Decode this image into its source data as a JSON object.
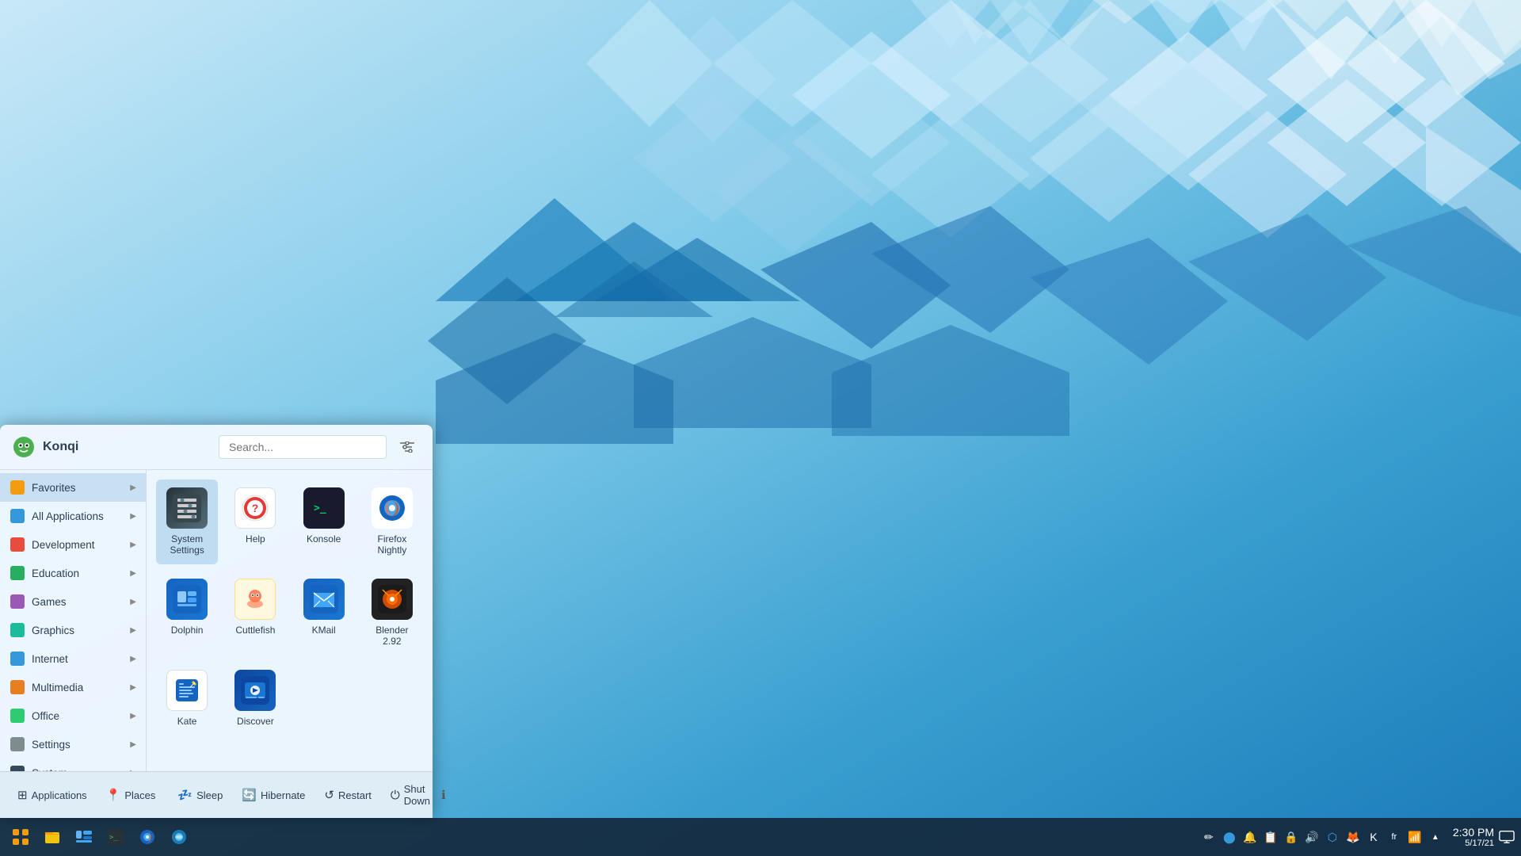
{
  "desktop": {
    "background_color": "#5ab4e0"
  },
  "menu": {
    "title": "Konqi",
    "search_placeholder": "Search...",
    "sidebar": {
      "items": [
        {
          "id": "favorites",
          "label": "Favorites",
          "icon": "☆",
          "active": true,
          "has_arrow": true
        },
        {
          "id": "all-applications",
          "label": "All Applications",
          "icon": "⊞",
          "active": false,
          "has_arrow": true
        },
        {
          "id": "development",
          "label": "Development",
          "icon": "🔧",
          "active": false,
          "has_arrow": true
        },
        {
          "id": "education",
          "label": "Education",
          "icon": "🎓",
          "active": false,
          "has_arrow": true
        },
        {
          "id": "games",
          "label": "Games",
          "icon": "🎮",
          "active": false,
          "has_arrow": true
        },
        {
          "id": "graphics",
          "label": "Graphics",
          "icon": "🎨",
          "active": false,
          "has_arrow": true
        },
        {
          "id": "internet",
          "label": "Internet",
          "icon": "🌐",
          "active": false,
          "has_arrow": true
        },
        {
          "id": "multimedia",
          "label": "Multimedia",
          "icon": "🎵",
          "active": false,
          "has_arrow": true
        },
        {
          "id": "office",
          "label": "Office",
          "icon": "📄",
          "active": false,
          "has_arrow": true
        },
        {
          "id": "settings",
          "label": "Settings",
          "icon": "⚙",
          "active": false,
          "has_arrow": true
        },
        {
          "id": "system",
          "label": "System",
          "icon": "💻",
          "active": false,
          "has_arrow": true
        }
      ]
    },
    "apps": [
      {
        "id": "system-settings",
        "label": "System Settings",
        "icon_type": "system-settings",
        "icon_char": "⚙"
      },
      {
        "id": "help",
        "label": "Help",
        "icon_type": "help",
        "icon_char": "🆘"
      },
      {
        "id": "konsole",
        "label": "Konsole",
        "icon_type": "konsole",
        "icon_char": ">_"
      },
      {
        "id": "firefox-nightly",
        "label": "Firefox Nightly",
        "icon_type": "firefox",
        "icon_char": "🦊"
      },
      {
        "id": "dolphin",
        "label": "Dolphin",
        "icon_type": "dolphin",
        "icon_char": "📁"
      },
      {
        "id": "cuttlefish",
        "label": "Cuttlefish",
        "icon_type": "cuttlefish",
        "icon_char": "🐟"
      },
      {
        "id": "kmail",
        "label": "KMail",
        "icon_type": "kmail",
        "icon_char": "✉"
      },
      {
        "id": "blender",
        "label": "Blender 2.92",
        "icon_type": "blender",
        "icon_char": "🔵"
      },
      {
        "id": "kate",
        "label": "Kate",
        "icon_type": "kate",
        "icon_char": "✏"
      },
      {
        "id": "discover",
        "label": "Discover",
        "icon_type": "discover",
        "icon_char": "🛒"
      }
    ],
    "footer": {
      "applications_label": "Applications",
      "places_label": "Places",
      "sleep_label": "Sleep",
      "hibernate_label": "Hibernate",
      "restart_label": "Restart",
      "shutdown_label": "Shut Down"
    }
  },
  "taskbar": {
    "icons": [
      {
        "id": "apps-grid",
        "char": "⊞",
        "color": "#f39c12"
      },
      {
        "id": "files",
        "char": "📁",
        "color": "#f1c40f"
      },
      {
        "id": "dolphin-task",
        "char": "🗂",
        "color": "#3498db"
      },
      {
        "id": "terminal-task",
        "char": "⬛",
        "color": "#2c3e50"
      },
      {
        "id": "firefox-task",
        "char": "🦊",
        "color": "#e67e22"
      },
      {
        "id": "konqueror-task",
        "char": "🌐",
        "color": "#2980b9"
      }
    ],
    "system_tray": [
      {
        "id": "pencil",
        "char": "✏",
        "title": "pencil"
      },
      {
        "id": "circle",
        "char": "⬤",
        "title": "indicator"
      },
      {
        "id": "alarm",
        "char": "🔔",
        "title": "notifications"
      },
      {
        "id": "clipboard",
        "char": "📋",
        "title": "clipboard"
      },
      {
        "id": "lock",
        "char": "🔒",
        "title": "lock"
      },
      {
        "id": "volume",
        "char": "🔊",
        "title": "volume"
      },
      {
        "id": "bluetooth",
        "char": "🔵",
        "title": "bluetooth"
      },
      {
        "id": "firefox-tray",
        "char": "🦊",
        "title": "firefox"
      },
      {
        "id": "konqueror-tray",
        "char": "K",
        "title": "konqueror"
      },
      {
        "id": "lang",
        "char": "fr",
        "title": "language"
      },
      {
        "id": "wifi",
        "char": "📶",
        "title": "wifi"
      },
      {
        "id": "battery-expand",
        "char": "▲",
        "title": "expand"
      }
    ],
    "clock": {
      "time": "2:30 PM",
      "date": "5/17/21"
    },
    "screen-icon": "⬜"
  }
}
